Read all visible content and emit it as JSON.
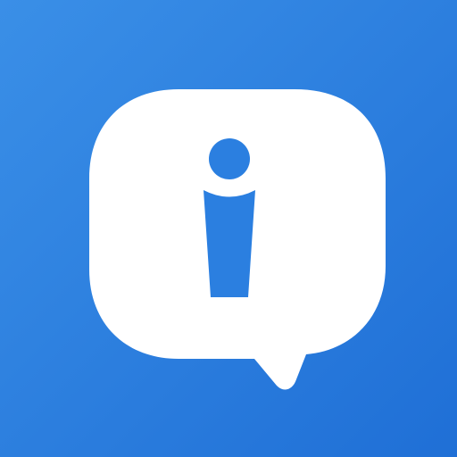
{
  "icon": {
    "name": "info-chat-bubble-icon",
    "background_start": "#3a8fe7",
    "background_end": "#1f6fd6",
    "bubble_color": "#ffffff",
    "glyph_color": "#2b7fe0"
  }
}
